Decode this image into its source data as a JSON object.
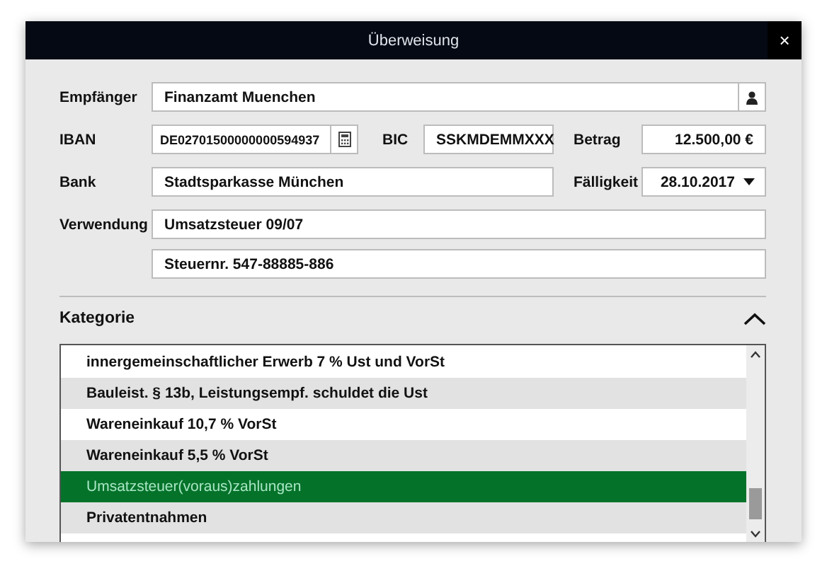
{
  "window": {
    "title": "Überweisung",
    "close": "×"
  },
  "form": {
    "recipient": {
      "label": "Empfänger",
      "value": "Finanzamt Muenchen"
    },
    "iban": {
      "label": "IBAN",
      "value": "DE02701500000000594937"
    },
    "bic": {
      "label": "BIC",
      "value": "SSKMDEMMXXX"
    },
    "amount": {
      "label": "Betrag",
      "value": "12.500,00 €"
    },
    "bank": {
      "label": "Bank",
      "value": "Stadtsparkasse München"
    },
    "due": {
      "label": "Fälligkeit",
      "value": "28.10.2017"
    },
    "purpose": {
      "label": "Verwendung",
      "lines": [
        "Umsatzsteuer 09/07",
        "Steuernr. 547-88885-886"
      ]
    }
  },
  "category": {
    "title": "Kategorie",
    "expanded": true,
    "items": [
      {
        "label": "innergemeinschaftlicher Erwerb 7 % Ust und VorSt",
        "selected": false
      },
      {
        "label": "Bauleist. § 13b, Leistungsempf. schuldet die Ust",
        "selected": false
      },
      {
        "label": "Wareneinkauf 10,7 % VorSt",
        "selected": false
      },
      {
        "label": "Wareneinkauf 5,5 % VorSt",
        "selected": false
      },
      {
        "label": "Umsatzsteuer(voraus)zahlungen",
        "selected": true
      },
      {
        "label": "Privatentnahmen",
        "selected": false
      }
    ]
  }
}
